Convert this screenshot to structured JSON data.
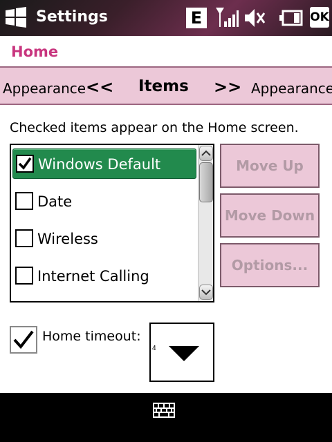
{
  "titlebar": {
    "title": "Settings",
    "indicator_e": "E",
    "ok_label": "OK",
    "icons": [
      "windows-start-icon",
      "signal-icon",
      "speaker-muted-icon",
      "battery-icon"
    ]
  },
  "header": {
    "title": "Home"
  },
  "tabs": {
    "previous": "Appearance",
    "previous_arrow": "<<",
    "current": "Items",
    "next_arrow": ">>",
    "next": "Appearance"
  },
  "instruction": "Checked items appear on the Home screen.",
  "items": [
    {
      "label": "Windows Default",
      "checked": true,
      "selected": true
    },
    {
      "label": "Date",
      "checked": false,
      "selected": false
    },
    {
      "label": "Wireless",
      "checked": false,
      "selected": false
    },
    {
      "label": "Internet Calling",
      "checked": false,
      "selected": false
    }
  ],
  "buttons": {
    "move_up": "Move Up",
    "move_down": "Move Down",
    "options": "Options..."
  },
  "timeout": {
    "label": "Home timeout:",
    "checked": true,
    "value": "4"
  },
  "colors": {
    "accent": "#c8357e",
    "tab_background": "#ecc8d8",
    "selection": "#228a4d",
    "disabled_text": "#b29aa5"
  },
  "softkeys": {
    "center_icon": "keyboard-icon"
  }
}
